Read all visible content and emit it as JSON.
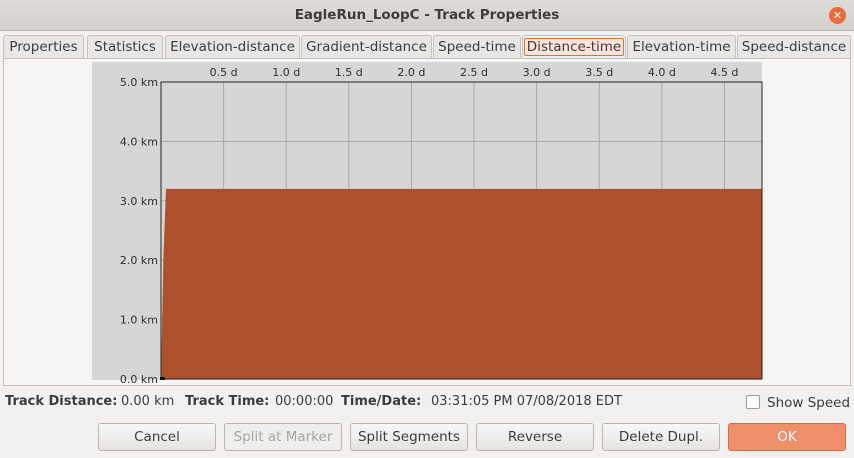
{
  "window": {
    "title": "EagleRun_LoopC - Track Properties"
  },
  "tabs": [
    {
      "label": "Properties"
    },
    {
      "label": "Statistics"
    },
    {
      "label": "Elevation-distance"
    },
    {
      "label": "Gradient-distance"
    },
    {
      "label": "Speed-time"
    },
    {
      "label": "Distance-time"
    },
    {
      "label": "Elevation-time"
    },
    {
      "label": "Speed-distance"
    }
  ],
  "active_tab": "Distance-time",
  "chart_data": {
    "type": "area",
    "x_ticks": [
      "0.5 d",
      "1.0 d",
      "1.5 d",
      "2.0 d",
      "2.5 d",
      "3.0 d",
      "3.5 d",
      "4.0 d",
      "4.5 d"
    ],
    "y_ticks": [
      "0.0 km",
      "1.0 km",
      "2.0 km",
      "3.0 km",
      "4.0 km",
      "5.0 km"
    ],
    "x_values": [
      0,
      0.02,
      0.04,
      4.8
    ],
    "y_values": [
      0,
      2.1,
      3.2,
      3.2
    ],
    "xlim": [
      0,
      4.8
    ],
    "ylim": [
      0,
      5
    ],
    "fill_color": "#ad502c",
    "background_color": "#d6d6d6",
    "grid": true
  },
  "status": {
    "track_distance_label": "Track Distance:",
    "track_distance_value": "0.00 km",
    "track_time_label": "Track Time:",
    "track_time_value": "00:00:00",
    "time_date_label": "Time/Date:",
    "time_date_value": "03:31:05 PM 07/08/2018 EDT",
    "show_speed_label": "Show Speed",
    "show_speed_checked": false
  },
  "buttons": {
    "cancel": "Cancel",
    "split_at_marker": "Split at Marker",
    "split_segments": "Split Segments",
    "reverse": "Reverse",
    "delete_dupl": "Delete Dupl.",
    "ok": "OK"
  }
}
